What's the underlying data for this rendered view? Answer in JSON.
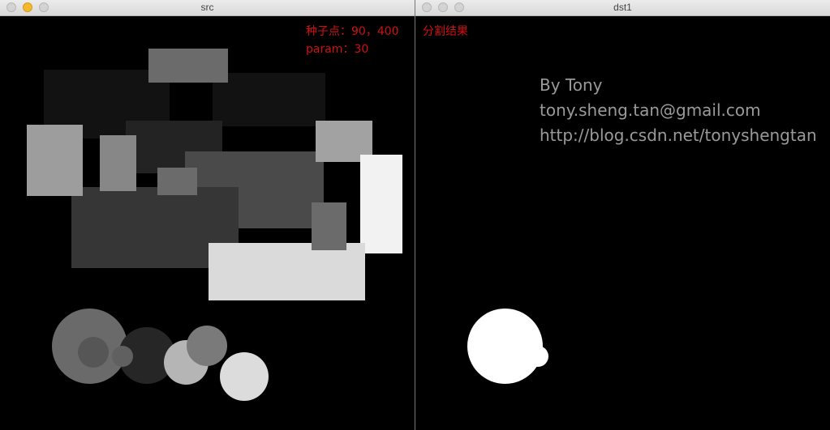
{
  "windows": {
    "src": {
      "title": "src"
    },
    "dst": {
      "title": "dst1"
    }
  },
  "overlay": {
    "seed_line": "种子点：90，400",
    "result_label": "分割结果",
    "param_line": "param：30"
  },
  "credits": {
    "author": "By Tony",
    "email": "tony.sheng.tan@gmail.com",
    "url": "http://blog.csdn.net/tonyshengtan"
  },
  "colors": {
    "background": "#000000",
    "overlay_text": "#d01010",
    "result_fill": "#ffffff"
  }
}
